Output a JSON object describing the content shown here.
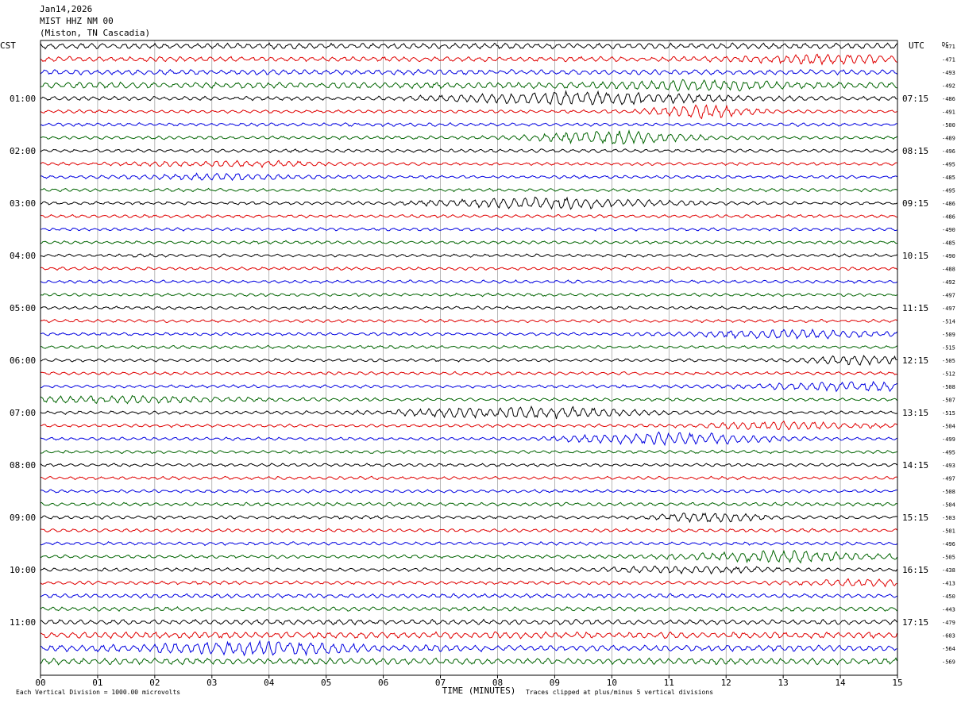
{
  "header": {
    "date": "Jan14,2026",
    "station": "MIST HHZ NM 00",
    "location": "(Miston, TN Cascadia)"
  },
  "chart_data": {
    "type": "line",
    "title": "Jan14,2026 MIST HHZ NM 00 (Miston, TN Cascadia)",
    "xlabel": "TIME (MINUTES)",
    "xlim": [
      0,
      15
    ],
    "x_ticks": [
      "00",
      "01",
      "02",
      "03",
      "04",
      "05",
      "06",
      "07",
      "08",
      "09",
      "10",
      "11",
      "12",
      "13",
      "14",
      "15"
    ],
    "left_axis_label": "CST",
    "right_axis_label": "UTC",
    "dc_label": "DC",
    "left_time_labels": [
      "01:00",
      "02:00",
      "03:00",
      "04:00",
      "05:00",
      "06:00",
      "07:00",
      "08:00",
      "09:00",
      "10:00",
      "11:00"
    ],
    "right_time_labels": [
      "07:15",
      "08:15",
      "09:15",
      "10:15",
      "11:15",
      "12:15",
      "13:15",
      "14:15",
      "15:15",
      "16:15",
      "17:15"
    ],
    "trace_colors": [
      "#000000",
      "#e00000",
      "#0000e0",
      "#006400"
    ],
    "dc_offsets": [
      -471,
      -471,
      -493,
      -492,
      -486,
      -491,
      -500,
      -489,
      -496,
      -495,
      -485,
      -495,
      -486,
      -486,
      -490,
      -485,
      -490,
      -488,
      -492,
      -497,
      -497,
      -514,
      -509,
      -515,
      -505,
      -512,
      -508,
      -507,
      -515,
      -504,
      -499,
      -495,
      -493,
      -497,
      -508,
      -504,
      -503,
      -501,
      -496,
      -505,
      -438,
      -413,
      -450,
      -443,
      -479,
      -603,
      -564,
      -569
    ],
    "activity_level": [
      2.5,
      2.2,
      2.2,
      2.8,
      1.8,
      1.4,
      1.4,
      1.4,
      1.4,
      1.3,
      1.3,
      1.3,
      1.3,
      1.3,
      1.3,
      1.3,
      1.3,
      1.3,
      1.3,
      1.3,
      1.3,
      1.3,
      1.3,
      1.3,
      1.3,
      1.3,
      1.3,
      1.3,
      1.4,
      1.3,
      1.3,
      1.3,
      1.3,
      1.3,
      1.3,
      1.5,
      1.4,
      1.4,
      1.4,
      1.4,
      1.5,
      1.5,
      1.8,
      1.8,
      2.2,
      2.8,
      2.8,
      2.8
    ],
    "footer_left": "Each Vertical Division = 1000.00 microvolts",
    "footer_right": "Traces clipped at plus/minus 5 vertical divisions",
    "grid": "vertical lines at each minute"
  }
}
